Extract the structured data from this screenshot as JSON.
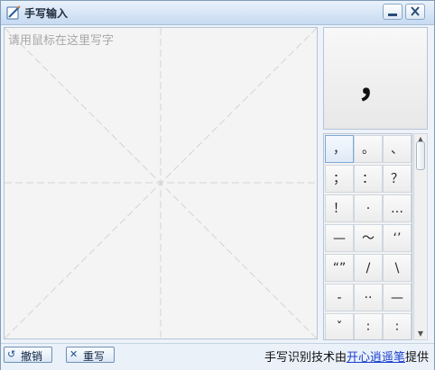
{
  "window": {
    "title": "手写输入",
    "app_icon": "pen-pad-icon",
    "minimize_icon": "minimize-icon",
    "close_icon": "close-icon"
  },
  "canvas": {
    "hint": "请用鼠标在这里写字"
  },
  "preview": {
    "char": "，"
  },
  "candidates": [
    [
      "，",
      "。",
      "、"
    ],
    [
      "；",
      "：",
      "？"
    ],
    [
      "！",
      "·",
      "…"
    ],
    [
      "—",
      "～",
      "‘’"
    ],
    [
      "“”",
      "/",
      "\\"
    ],
    [
      "-",
      "··",
      "—"
    ],
    [
      "ˇ",
      "∶",
      "∶"
    ]
  ],
  "scrollbar": {
    "up_icon": "scroll-up-arrow-icon",
    "down_icon": "scroll-down-arrow-icon"
  },
  "bottom": {
    "undo_label": "撤销",
    "undo_icon": "undo-arrow-icon",
    "rewrite_label": "重写",
    "rewrite_icon": "clear-x-icon",
    "credit_prefix": "手写识别技术由",
    "credit_link": "开心逍遥笔",
    "credit_suffix": "提供"
  },
  "colors": {
    "link": "#1a3fd0",
    "titlebar": "#d6e5f6",
    "hint_text": "#a8a8a8"
  }
}
